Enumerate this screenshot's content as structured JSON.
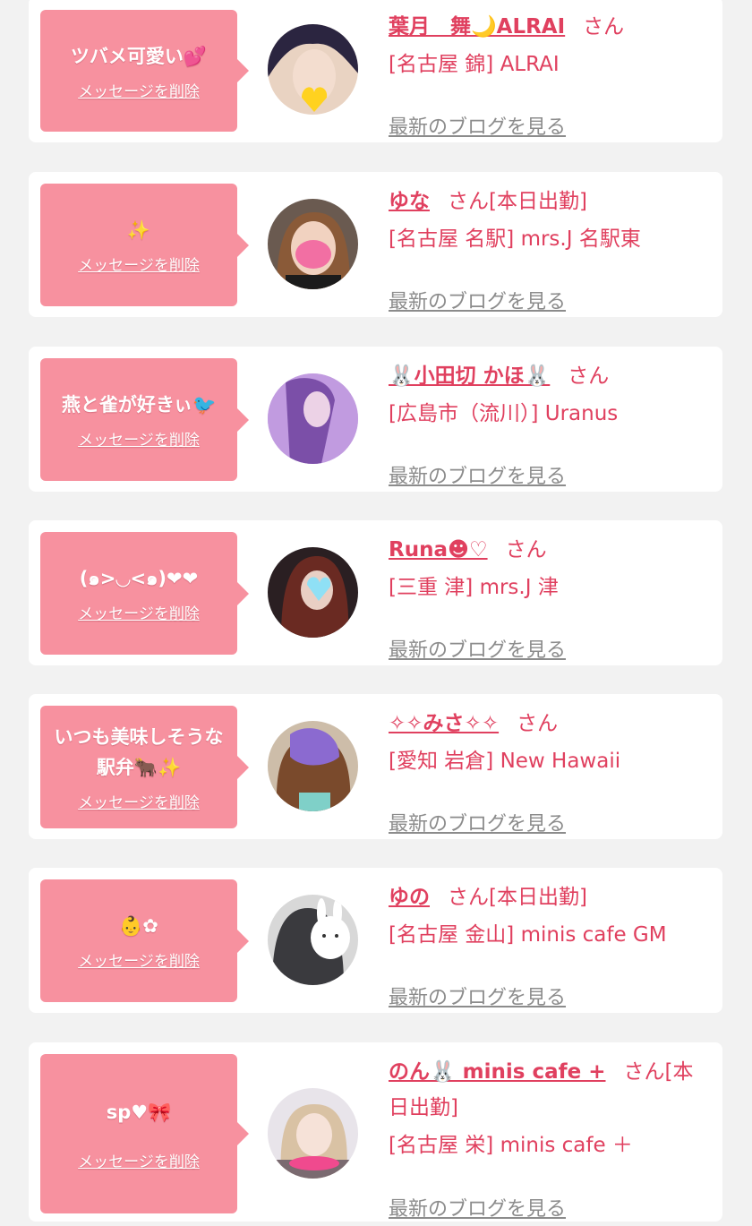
{
  "delete_label": "メッセージを削除",
  "blog_label": "最新のブログを見る",
  "colors": {
    "accent": "#e0405f",
    "bubble": "#f7919f",
    "link_gray": "#8c8c8c"
  },
  "favorites": [
    {
      "message": "ツバメ可愛い💕",
      "name": "葉月　舞🌙ALRAI",
      "suffix": "さん",
      "shop": "[名古屋 錦] ALRAI",
      "avatar_icon": "avatar-photo-icon"
    },
    {
      "message": "✨",
      "name": "ゆな",
      "suffix": "さん[本日出勤]",
      "shop": "[名古屋 名駅] mrs.J 名駅東",
      "avatar_icon": "avatar-photo-icon"
    },
    {
      "message": "燕と雀が好きぃ🐦",
      "name": "🐰小田切 かほ🐰",
      "suffix": "さん",
      "shop": "[広島市（流川）] Uranus",
      "avatar_icon": "avatar-photo-icon"
    },
    {
      "message": "(๑>◡<๑)❤❤",
      "name": "Runa☻♡",
      "suffix": "さん",
      "shop": "[三重 津] mrs.J 津",
      "avatar_icon": "avatar-photo-icon"
    },
    {
      "message": "いつも美味しそうな駅弁🐂✨",
      "name": "✧✧みさ✧✧",
      "suffix": "さん",
      "shop": "[愛知 岩倉] New Hawaii",
      "avatar_icon": "avatar-photo-icon"
    },
    {
      "message": "👶✿",
      "name": "ゆの",
      "suffix": "さん[本日出勤]",
      "shop": "[名古屋 金山] minis cafe GM",
      "avatar_icon": "avatar-photo-icon"
    },
    {
      "message": "sp♥🎀",
      "name": "のん🐰 minis cafe +",
      "suffix": "さん[本日出勤]",
      "shop": "[名古屋 栄] minis cafe ＋",
      "avatar_icon": "avatar-photo-icon"
    }
  ]
}
